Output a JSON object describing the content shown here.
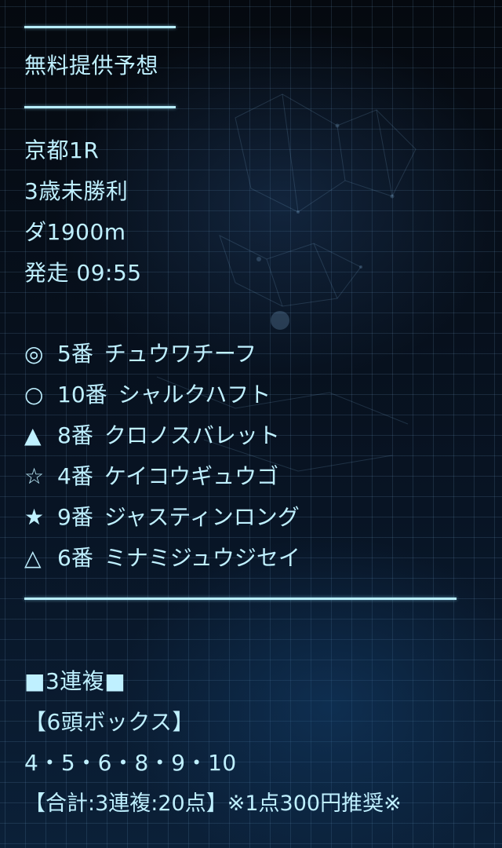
{
  "heading": "無料提供予想",
  "race": {
    "venue": "京都1R",
    "class": "3歳未勝利",
    "course": "ダ1900m",
    "start": "発走 09:55"
  },
  "picks": [
    {
      "mark": "◎",
      "number": "5番",
      "horse": "チュウワチーフ"
    },
    {
      "mark": "○",
      "number": "10番",
      "horse": "シャルクハフト"
    },
    {
      "mark": "▲",
      "number": "8番",
      "horse": "クロノスバレット"
    },
    {
      "mark": "☆",
      "number": "4番",
      "horse": "ケイコウギュウゴ"
    },
    {
      "mark": "★",
      "number": "9番",
      "horse": "ジャスティンロング"
    },
    {
      "mark": "△",
      "number": "6番",
      "horse": "ミナミジュウジセイ"
    }
  ],
  "bet": {
    "type": "■3連複■",
    "format": "【6頭ボックス】",
    "numbers": "4・5・6・8・9・10",
    "total": "【合計:3連複:20点】※1点300円推奨※"
  },
  "colors": {
    "text": "#bff0ff",
    "rule": "#b8eefc",
    "background": "#050b14"
  }
}
